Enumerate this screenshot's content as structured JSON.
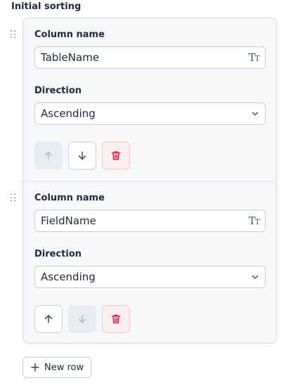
{
  "section": {
    "title": "Initial sorting"
  },
  "rows": [
    {
      "column_label": "Column name",
      "column_value": "TableName",
      "direction_label": "Direction",
      "direction_value": "Ascending",
      "controls": {
        "up_enabled": false,
        "down_enabled": true
      }
    },
    {
      "column_label": "Column name",
      "column_value": "FieldName",
      "direction_label": "Direction",
      "direction_value": "Ascending",
      "controls": {
        "up_enabled": true,
        "down_enabled": false
      }
    }
  ],
  "icons": {
    "drag": "drag-handle-icon",
    "text_type": "text-type-icon",
    "chevron": "chevron-down-icon",
    "up": "arrow-up-icon",
    "down": "arrow-down-icon",
    "delete": "trash-icon",
    "add": "plus-icon"
  },
  "colors": {
    "danger": "#e11d48",
    "disabled_bg": "#e8ebf0",
    "panel_bg": "#f7f8fa"
  },
  "footer": {
    "new_row_label": "New row"
  }
}
